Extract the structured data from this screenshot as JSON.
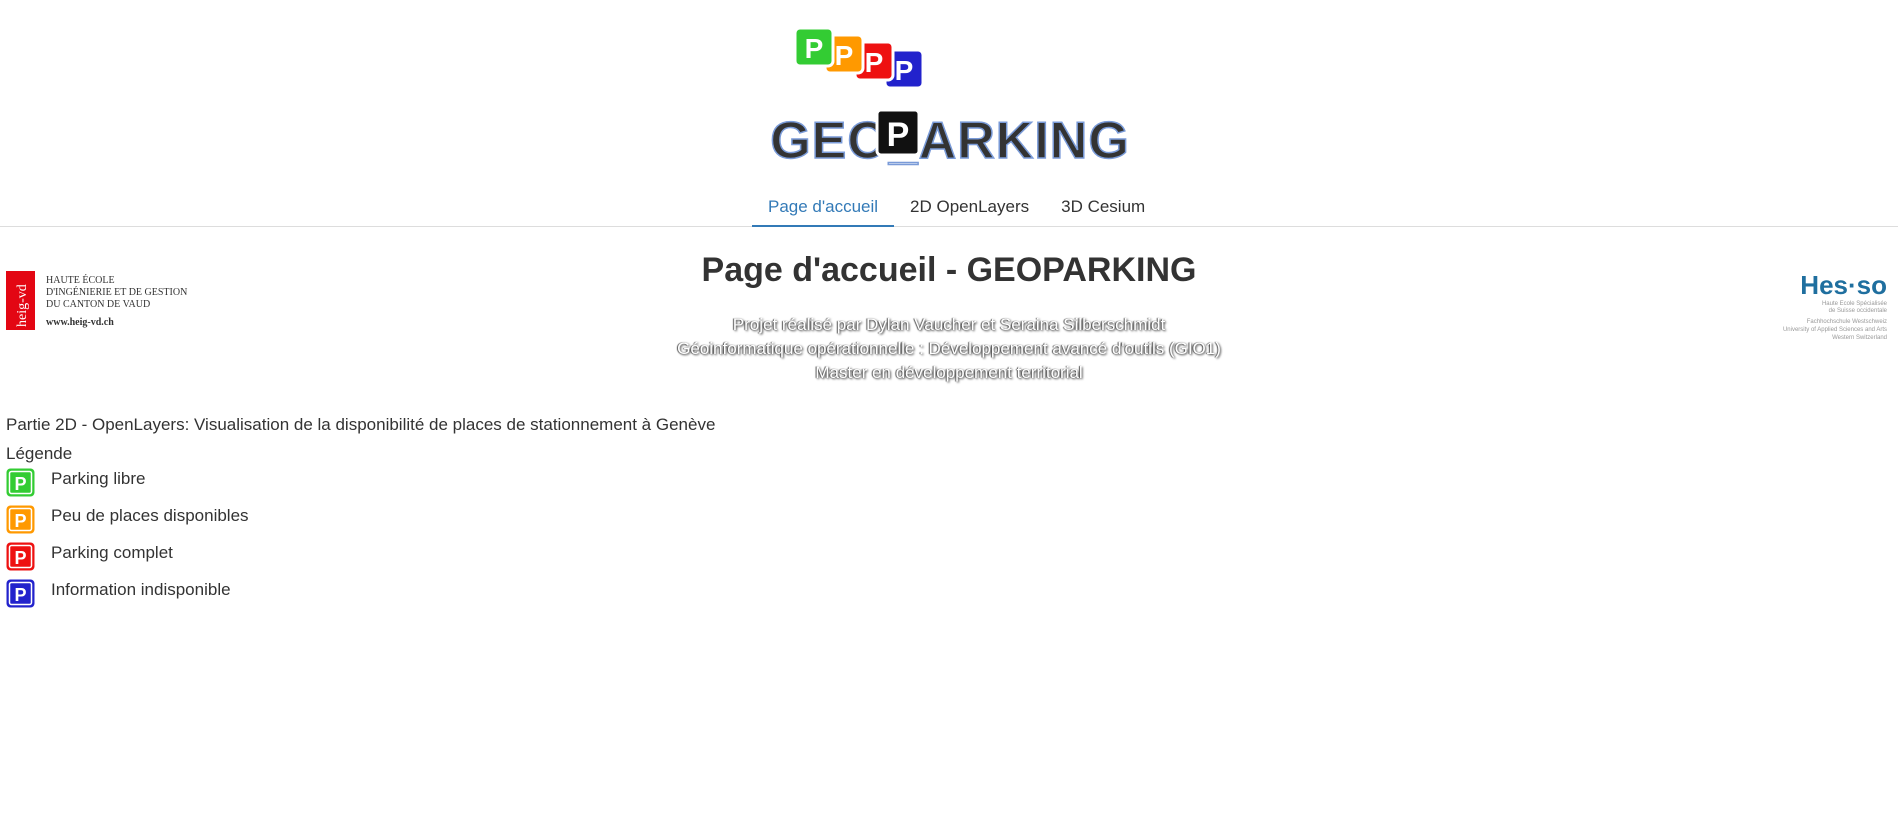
{
  "header": {
    "logo_text": "GEOPARKING",
    "logo_icon_letter": "P"
  },
  "nav": {
    "tabs": [
      {
        "label": "Page d'accueil",
        "active": true
      },
      {
        "label": "2D OpenLayers",
        "active": false
      },
      {
        "label": "3D Cesium",
        "active": false
      }
    ]
  },
  "left_logo": {
    "side_text": "heig-vd",
    "lines": [
      "HAUTE ÉCOLE",
      "D'INGÉNIERIE ET DE GESTION",
      "DU CANTON DE VAUD"
    ],
    "url": "www.heig-vd.ch"
  },
  "right_logo": {
    "brand": "Hes·so",
    "lines": [
      "Haute Ecole Spécialisée",
      "de Suisse occidentale",
      "Fachhochschule Westschweiz",
      "University of Applied Sciences and Arts",
      "Western Switzerland"
    ]
  },
  "main": {
    "title": "Page d'accueil - GEOPARKING",
    "credits": [
      "Projet réalisé par Dylan Vaucher et Seraina Silberschmidt",
      "Géoinformatique opérationnelle : Développement avancé d'outils (GIO1)",
      "Master en développement territorial"
    ],
    "intro": "Partie 2D - OpenLayers: Visualisation de la disponibilité de places de stationnement à Genève",
    "legend_title": "Légende",
    "legend": [
      {
        "label": "Parking libre",
        "color": "#33cc33"
      },
      {
        "label": "Peu de places disponibles",
        "color": "#ff9900"
      },
      {
        "label": "Parking complet",
        "color": "#ee1111"
      },
      {
        "label": "Information indisponible",
        "color": "#2222cc"
      }
    ]
  },
  "colors": {
    "accent": "#337ab7",
    "text": "#333333",
    "heig_red": "#e30613",
    "hes_blue": "#1f6f9f"
  }
}
